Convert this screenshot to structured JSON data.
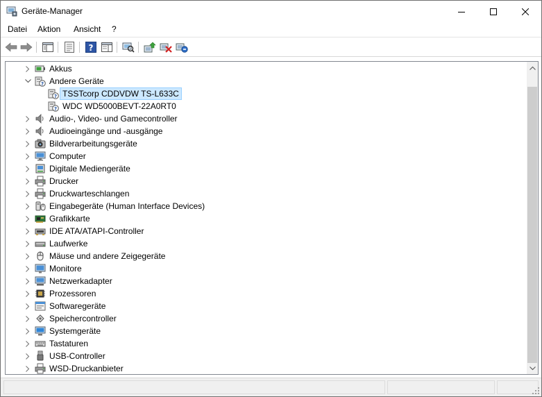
{
  "window": {
    "title": "Geräte-Manager"
  },
  "menu": {
    "items": [
      "Datei",
      "Aktion",
      "Ansicht",
      "?"
    ]
  },
  "toolbar": {
    "buttons": [
      "back-icon",
      "forward-icon",
      "show-hide-console-tree-icon",
      "properties-icon",
      "help-icon",
      "view-icon",
      "scan-hardware-icon",
      "update-driver-icon",
      "disable-device-icon",
      "uninstall-device-icon"
    ]
  },
  "tree": {
    "rows": [
      {
        "label": "Akkus",
        "icon": "battery-icon",
        "expanded": false,
        "level": 0
      },
      {
        "label": "Andere Geräte",
        "icon": "unknown-device-icon",
        "expanded": true,
        "level": 0
      },
      {
        "label": "TSSTcorp CDDVDW TS-L633C",
        "icon": "unknown-device-icon",
        "level": 1,
        "selected": true
      },
      {
        "label": "WDC WD5000BEVT-22A0RT0",
        "icon": "unknown-device-icon",
        "level": 1
      },
      {
        "label": "Audio-, Video- und Gamecontroller",
        "icon": "speaker-icon",
        "expanded": false,
        "level": 0
      },
      {
        "label": "Audioeingänge und -ausgänge",
        "icon": "speaker-icon",
        "expanded": false,
        "level": 0
      },
      {
        "label": "Bildverarbeitungsgeräte",
        "icon": "camera-icon",
        "expanded": false,
        "level": 0
      },
      {
        "label": "Computer",
        "icon": "computer-icon",
        "expanded": false,
        "level": 0
      },
      {
        "label": "Digitale Mediengeräte",
        "icon": "media-device-icon",
        "expanded": false,
        "level": 0
      },
      {
        "label": "Drucker",
        "icon": "printer-icon",
        "expanded": false,
        "level": 0
      },
      {
        "label": "Druckwarteschlangen",
        "icon": "printer-icon",
        "expanded": false,
        "level": 0
      },
      {
        "label": "Eingabegeräte (Human Interface Devices)",
        "icon": "hid-icon",
        "expanded": false,
        "level": 0
      },
      {
        "label": "Grafikkarte",
        "icon": "graphics-card-icon",
        "expanded": false,
        "level": 0
      },
      {
        "label": "IDE ATA/ATAPI-Controller",
        "icon": "ide-controller-icon",
        "expanded": false,
        "level": 0
      },
      {
        "label": "Laufwerke",
        "icon": "drive-icon",
        "expanded": false,
        "level": 0
      },
      {
        "label": "Mäuse und andere Zeigegeräte",
        "icon": "mouse-icon",
        "expanded": false,
        "level": 0
      },
      {
        "label": "Monitore",
        "icon": "monitor-icon",
        "expanded": false,
        "level": 0
      },
      {
        "label": "Netzwerkadapter",
        "icon": "network-adapter-icon",
        "expanded": false,
        "level": 0
      },
      {
        "label": "Prozessoren",
        "icon": "processor-icon",
        "expanded": false,
        "level": 0
      },
      {
        "label": "Softwaregeräte",
        "icon": "software-device-icon",
        "expanded": false,
        "level": 0
      },
      {
        "label": "Speichercontroller",
        "icon": "storage-controller-icon",
        "expanded": false,
        "level": 0
      },
      {
        "label": "Systemgeräte",
        "icon": "system-device-icon",
        "expanded": false,
        "level": 0
      },
      {
        "label": "Tastaturen",
        "icon": "keyboard-icon",
        "expanded": false,
        "level": 0
      },
      {
        "label": "USB-Controller",
        "icon": "usb-icon",
        "expanded": false,
        "level": 0
      },
      {
        "label": "WSD-Druckanbieter",
        "icon": "printer-icon",
        "expanded": false,
        "level": 0
      }
    ]
  },
  "colors": {
    "selection": "#cce8ff",
    "selection_border": "#99d1ff",
    "scroll_track": "#f0f0f0",
    "scroll_thumb": "#cdcdcd"
  }
}
